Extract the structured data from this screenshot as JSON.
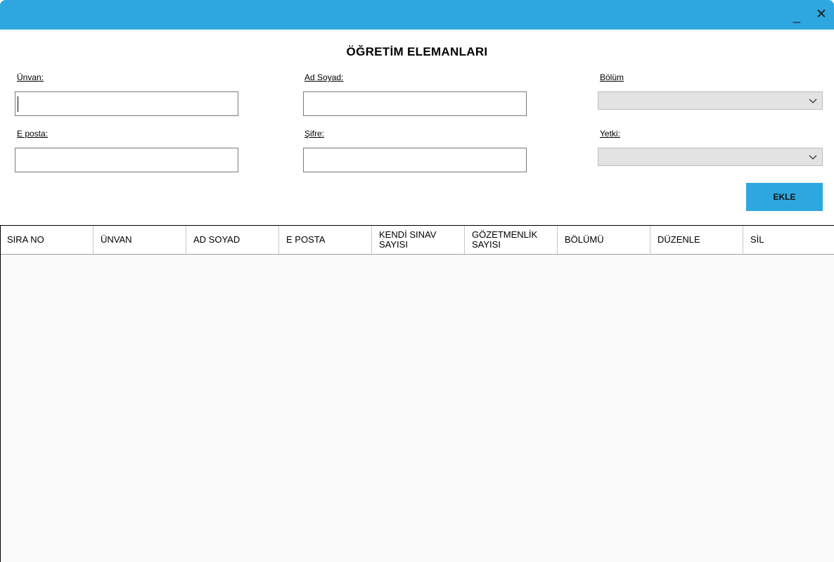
{
  "window": {
    "title_color": "#2ea7e0",
    "minimize_glyph": "_",
    "close_glyph": "✕"
  },
  "header": {
    "title": "ÖĞRETİM ELEMANLARI"
  },
  "form": {
    "unvan_label": "Ünvan:",
    "unvan_value": "",
    "adsoyad_label": "Ad Soyad:",
    "adsoyad_value": "",
    "bolum_label": "Bölüm",
    "bolum_selected": "",
    "eposta_label": "E posta:",
    "eposta_value": "",
    "sifre_label": "Şifre:",
    "sifre_value": "",
    "yetki_label": "Yetki:",
    "yetki_selected": "",
    "add_button": "EKLE"
  },
  "table": {
    "columns": [
      "SIRA NO",
      "ÜNVAN",
      "AD SOYAD",
      "E POSTA",
      "KENDİ SINAV\nSAYISI",
      "GÖZETMENLİK\nSAYISI",
      "BÖLÜMÜ",
      "DÜZENLE",
      "SİL"
    ],
    "rows": []
  }
}
